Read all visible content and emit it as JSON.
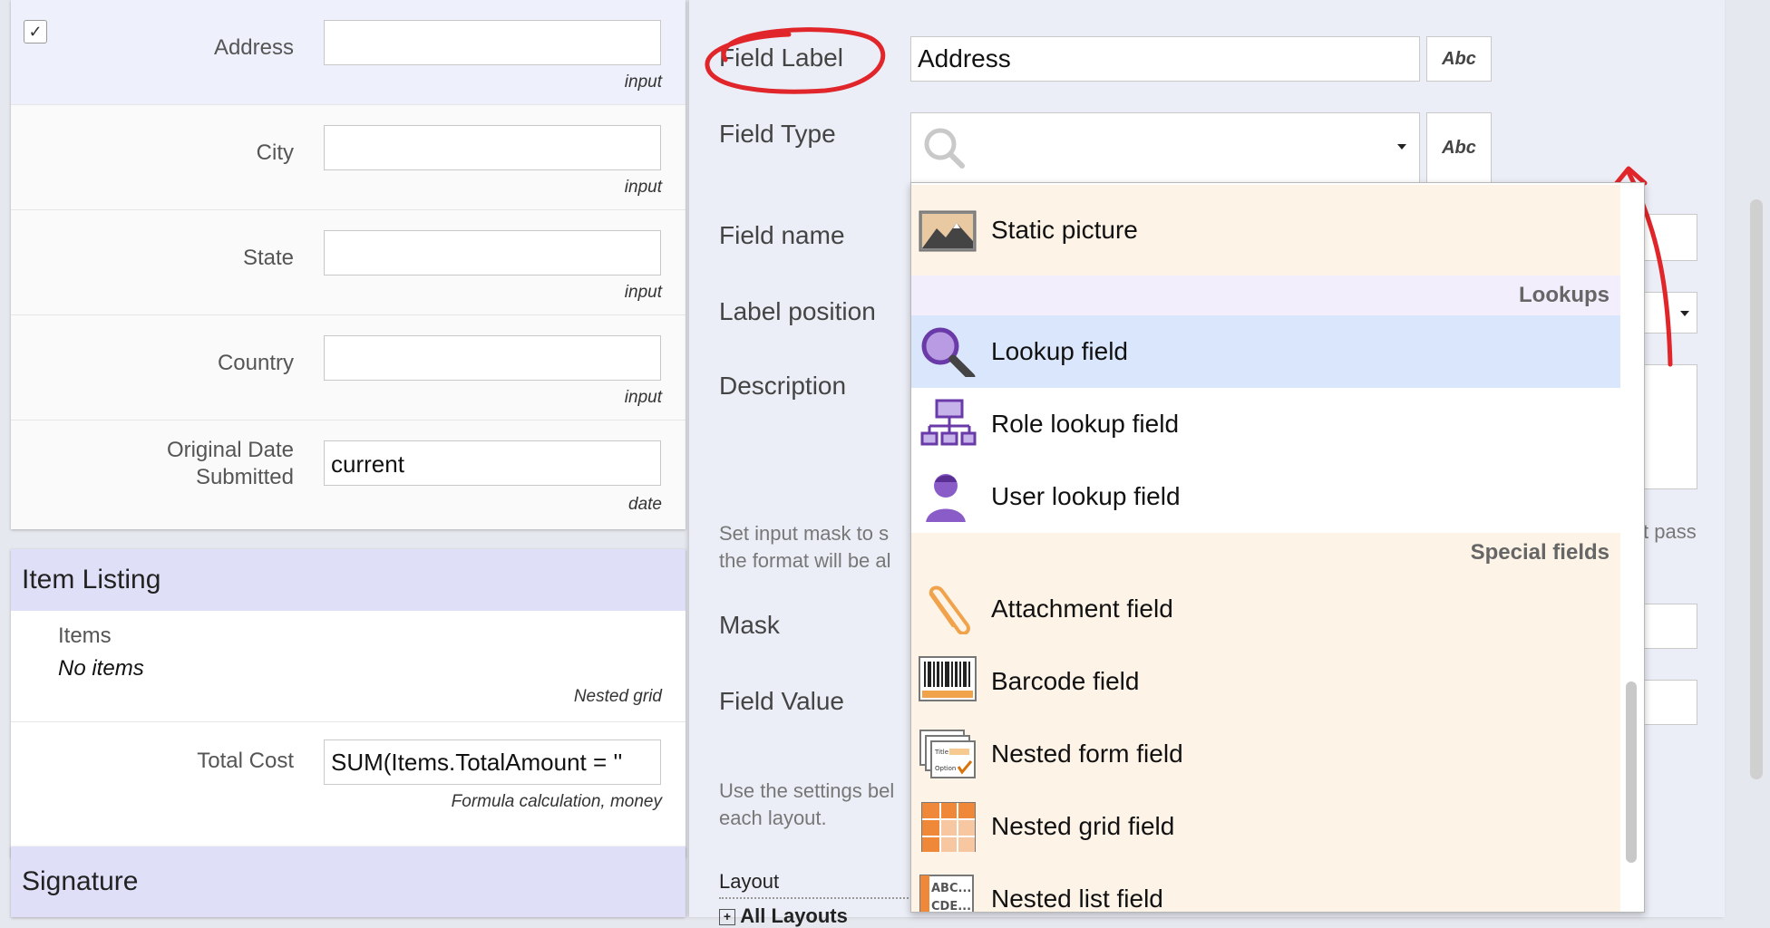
{
  "form": {
    "rows": [
      {
        "label": "Address",
        "value": "",
        "type": "input",
        "checked": true
      },
      {
        "label": "City",
        "value": "",
        "type": "input"
      },
      {
        "label": "State",
        "value": "",
        "type": "input"
      },
      {
        "label": "Country",
        "value": "",
        "type": "input"
      },
      {
        "label1": "Original Date",
        "label2": "Submitted",
        "value": "current",
        "type": "date"
      }
    ],
    "item_listing": {
      "title": "Item Listing",
      "items_label": "Items",
      "items_value": "No items",
      "items_type": "Nested grid",
      "total_label": "Total Cost",
      "total_value": "SUM(Items.TotalAmount = ''",
      "total_type": "Formula calculation, money"
    },
    "signature": {
      "title": "Signature"
    }
  },
  "properties": {
    "field_label": {
      "label": "Field Label",
      "value": "Address",
      "abc": "Abc"
    },
    "field_type": {
      "label": "Field Type",
      "abc": "Abc"
    },
    "field_name": "Field name",
    "label_position": "Label position",
    "description": "Description",
    "mask_hint_1": "Set input mask to s",
    "mask_hint_1_end": "t pass",
    "mask_hint_2": "the format will be al",
    "mask": "Mask",
    "field_value": "Field Value",
    "layout_hint_1": "Use the settings bel",
    "layout_hint_2": "each layout.",
    "layout": "Layout",
    "all_layouts": "All Layouts"
  },
  "dropdown": {
    "static_picture": "Static picture",
    "lookups_header": "Lookups",
    "lookup_field": "Lookup field",
    "role_lookup_field": "Role lookup field",
    "user_lookup_field": "User lookup field",
    "special_header": "Special fields",
    "attachment_field": "Attachment field",
    "barcode_field": "Barcode field",
    "nested_form_field": "Nested form field",
    "nested_grid_field": "Nested grid field",
    "nested_list_field": "Nested list field",
    "nested_form_icon_title": "Title",
    "nested_form_icon_option": "Option",
    "nested_list_icon_abc": "ABC...",
    "nested_list_icon_cde": "CDE..."
  },
  "colors": {
    "annotation_red": "#e0262b",
    "section_header_bg": "#dfe0f7",
    "hover_row": "#d9e6fb",
    "cream_row": "#fdf3e7"
  }
}
